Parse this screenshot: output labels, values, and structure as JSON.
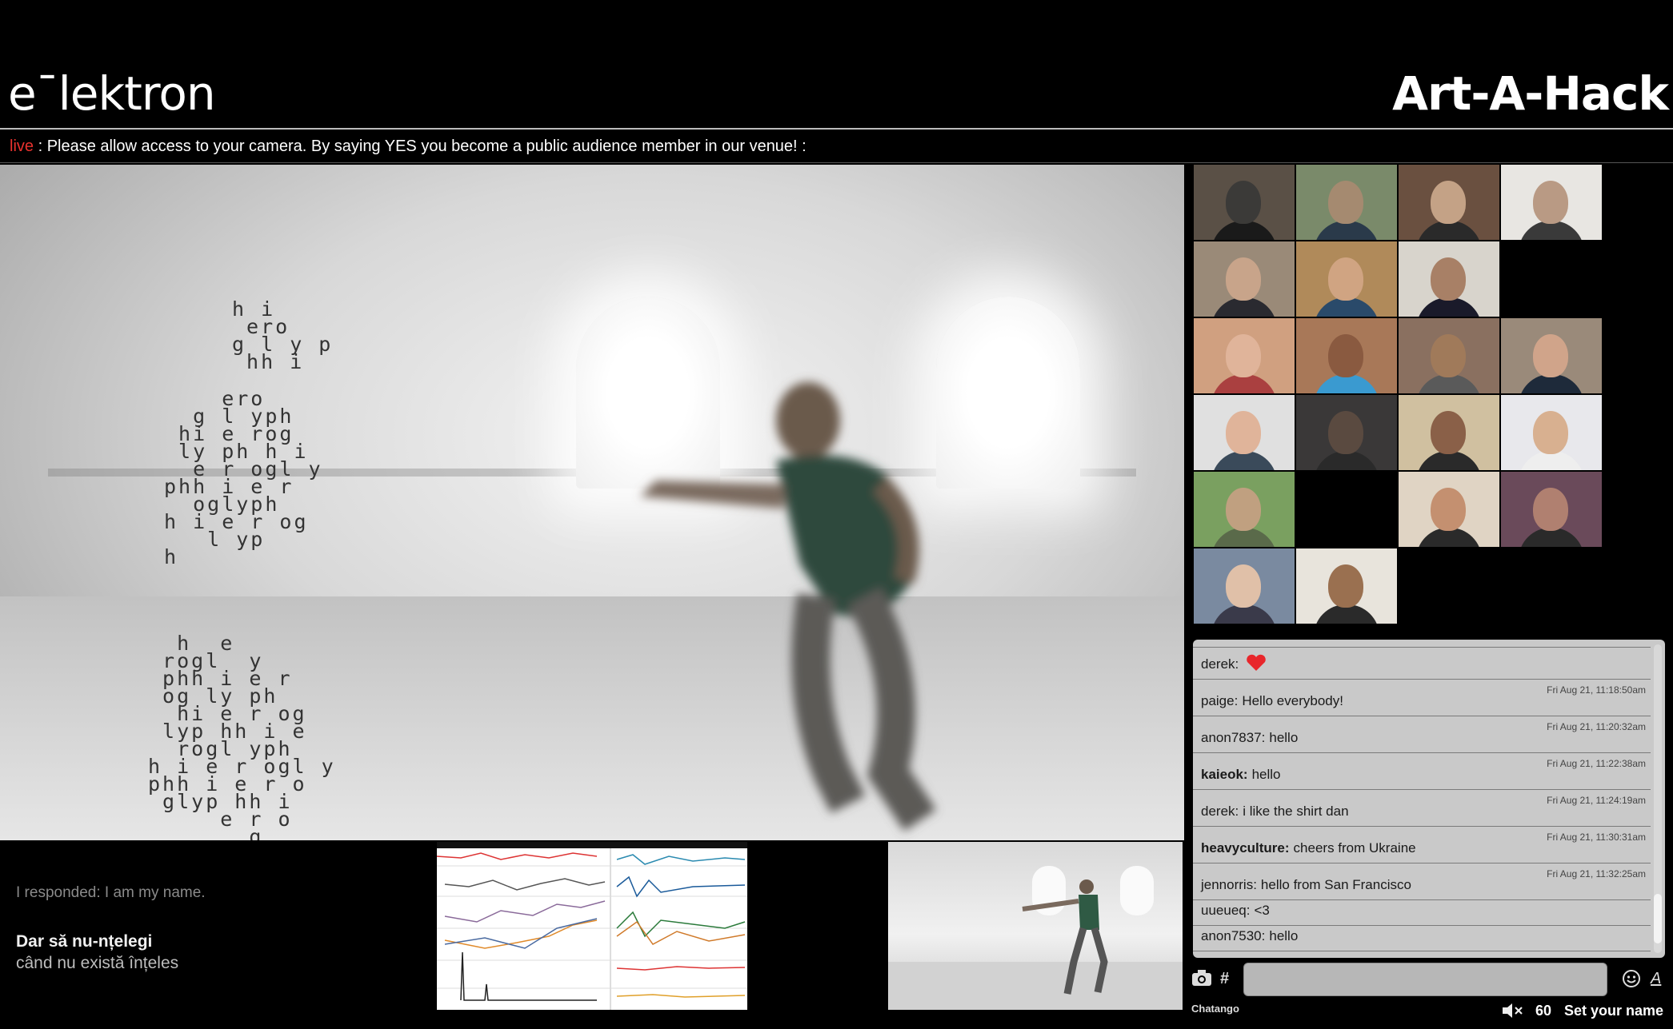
{
  "header": {
    "logo": "e¯lektron",
    "event_title": "Art-A-Hack"
  },
  "ticker": {
    "live_label": "live",
    "separator": ":",
    "message": "Please allow access to your camera. By saying YES you become a public audience member in our venue! :"
  },
  "main_video": {
    "glyph_block_1": "h i\n ero\ng l y p\n hh i",
    "glyph_block_2": "    ero\n  g l yph\n hi e rog\n ly ph h i\n  e r ogl y\nphh i e r\n  oglyph\nh i e r og\n   l yp\nh",
    "glyph_block_3": "  h  e\n rogl  y\n phh i e r\n og ly ph\n  hi e r og\n lyp hh i e\n  rogl yph\nh i e r ogl y\nphh i e r o\n glyp hh i\n     e r o\n       g"
  },
  "subtitles": {
    "previous": "I responded: I am my name.",
    "line1": "Dar să nu-nțelegi",
    "line2": "când nu există înțeles"
  },
  "chat": {
    "messages": [
      {
        "user": "derek:",
        "text": "",
        "timestamp": "",
        "bold": false,
        "heart": true
      },
      {
        "user": "paige:",
        "text": "Hello everybody!",
        "timestamp": "Fri Aug 21, 11:18:50am",
        "bold": false
      },
      {
        "user": "anon7837:",
        "text": "hello",
        "timestamp": "Fri Aug 21, 11:20:32am",
        "bold": false
      },
      {
        "user": "kaieok:",
        "text": "hello",
        "timestamp": "Fri Aug 21, 11:22:38am",
        "bold": true
      },
      {
        "user": "derek:",
        "text": "i like the shirt dan",
        "timestamp": "Fri Aug 21, 11:24:19am",
        "bold": false
      },
      {
        "user": "heavyculture:",
        "text": "cheers from Ukraine",
        "timestamp": "Fri Aug 21, 11:30:31am",
        "bold": true
      },
      {
        "user": "jennorris:",
        "text": "hello from San Francisco",
        "timestamp": "Fri Aug 21, 11:32:25am",
        "bold": false
      },
      {
        "user": "uueueq:",
        "text": "<3",
        "timestamp": "",
        "bold": false
      },
      {
        "user": "anon7530:",
        "text": "hello",
        "timestamp": "",
        "bold": false
      }
    ],
    "input_value": "",
    "hash_label": "#",
    "font_label": "A",
    "brand": "Chatango",
    "user_count": "60",
    "set_name_label": "Set your name"
  },
  "colors": {
    "live": "#e8322e",
    "chat_bg": "#c9c9c9",
    "heart": "#e8262b"
  }
}
